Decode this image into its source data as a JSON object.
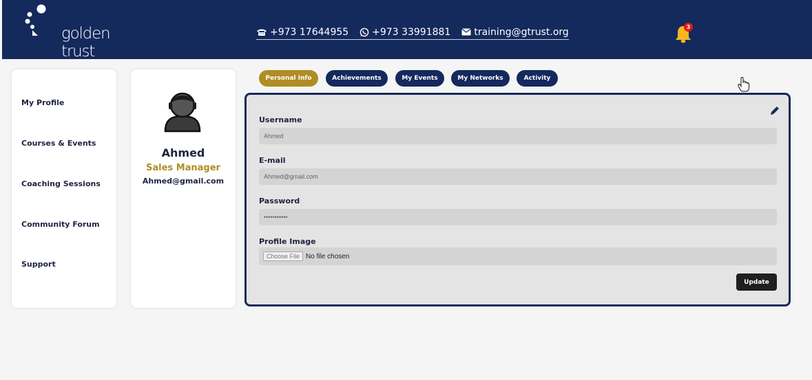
{
  "brand": {
    "logo_text": "golden trust"
  },
  "contact": {
    "phone": "+973 17644955",
    "whatsapp": "+973 33991881",
    "email": "training@gtrust.org",
    "phone_icon": "telephone-icon",
    "whatsapp_icon": "whatsapp-icon",
    "email_icon": "envelope-icon"
  },
  "notifications": {
    "count": "3",
    "icon": "bell-icon"
  },
  "sidebar": {
    "items": [
      {
        "label": "My Profile"
      },
      {
        "label": "Courses & Events"
      },
      {
        "label": "Coaching Sessions"
      },
      {
        "label": "Community Forum"
      },
      {
        "label": "Support"
      }
    ]
  },
  "profile": {
    "name": "Ahmed",
    "role": "Sales Manager",
    "email": "Ahmed@gmail.com",
    "avatar_icon": "user-avatar-icon"
  },
  "tabs": [
    {
      "label": "Personal Info",
      "active": true
    },
    {
      "label": "Achievements",
      "active": false
    },
    {
      "label": "My Events",
      "active": false
    },
    {
      "label": "My Networks",
      "active": false
    },
    {
      "label": "Activity",
      "active": false
    }
  ],
  "form": {
    "username_label": "Username",
    "username_value": "Ahmed",
    "email_label": "E-mail",
    "email_value": "Ahmed@gmail.com",
    "password_label": "Password",
    "password_value": "•••••••••••",
    "image_label": "Profile Image",
    "file_button": "Choose File",
    "file_status": "No file chosen",
    "update_label": "Update"
  },
  "colors": {
    "navy": "#14295c",
    "gold": "#b08c25",
    "notification_red": "#e01a1a",
    "bell_yellow": "#f5b623"
  }
}
